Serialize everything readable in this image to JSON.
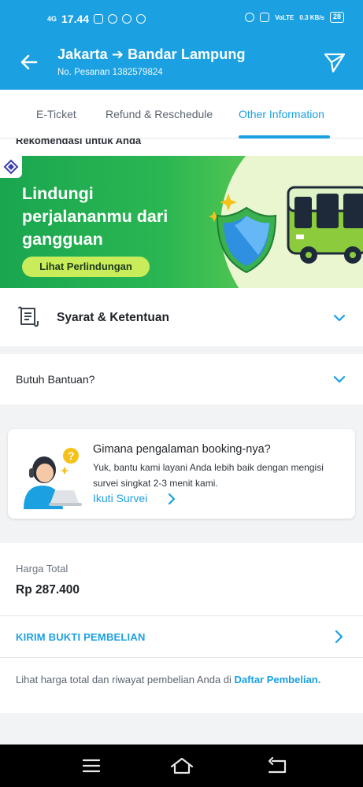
{
  "status_bar": {
    "signal": "4G",
    "time": "17.44",
    "network_type": "VoLTE",
    "speed": "0.3 KB/s",
    "battery": "28"
  },
  "header": {
    "title": "Jakarta ➔ Bandar Lampung",
    "order_number": "No. Pesanan 1382579824"
  },
  "tabs": [
    {
      "label": "E-Ticket",
      "active": false
    },
    {
      "label": "Refund & Reschedule",
      "active": false
    },
    {
      "label": "Other Information",
      "active": true
    }
  ],
  "recommendation": {
    "section_label": "Rekomendasi untuk Anda",
    "banner_text": "Lindungi perjalananmu dari gangguan",
    "banner_cta": "Lihat Perlindungan"
  },
  "terms": {
    "label": "Syarat & Ketentuan"
  },
  "help": {
    "label": "Butuh Bantuan?"
  },
  "survey": {
    "title": "Gimana pengalaman booking-nya?",
    "body": "Yuk, bantu kami layani Anda lebih baik dengan mengisi survei singkat 2-3 menit kami.",
    "link": "Ikuti Survei"
  },
  "price": {
    "label": "Harga Total",
    "value": "Rp 287.400"
  },
  "send_proof": {
    "label": "KIRIM BUKTI PEMBELIAN"
  },
  "history": {
    "text": "Lihat harga total dan riwayat pembelian Anda di",
    "link": "Daftar Pembelian."
  },
  "colors": {
    "primary": "#1ba0e2",
    "banner_green": "#2bb653",
    "cta_lime": "#c9ec5b",
    "text_dark": "#1f2328"
  },
  "icons": [
    "back-arrow-icon",
    "share-icon",
    "terms-document-icon",
    "chevron-down-icon",
    "chevron-right-icon",
    "nav-menu-icon",
    "nav-home-icon",
    "nav-back-icon"
  ]
}
